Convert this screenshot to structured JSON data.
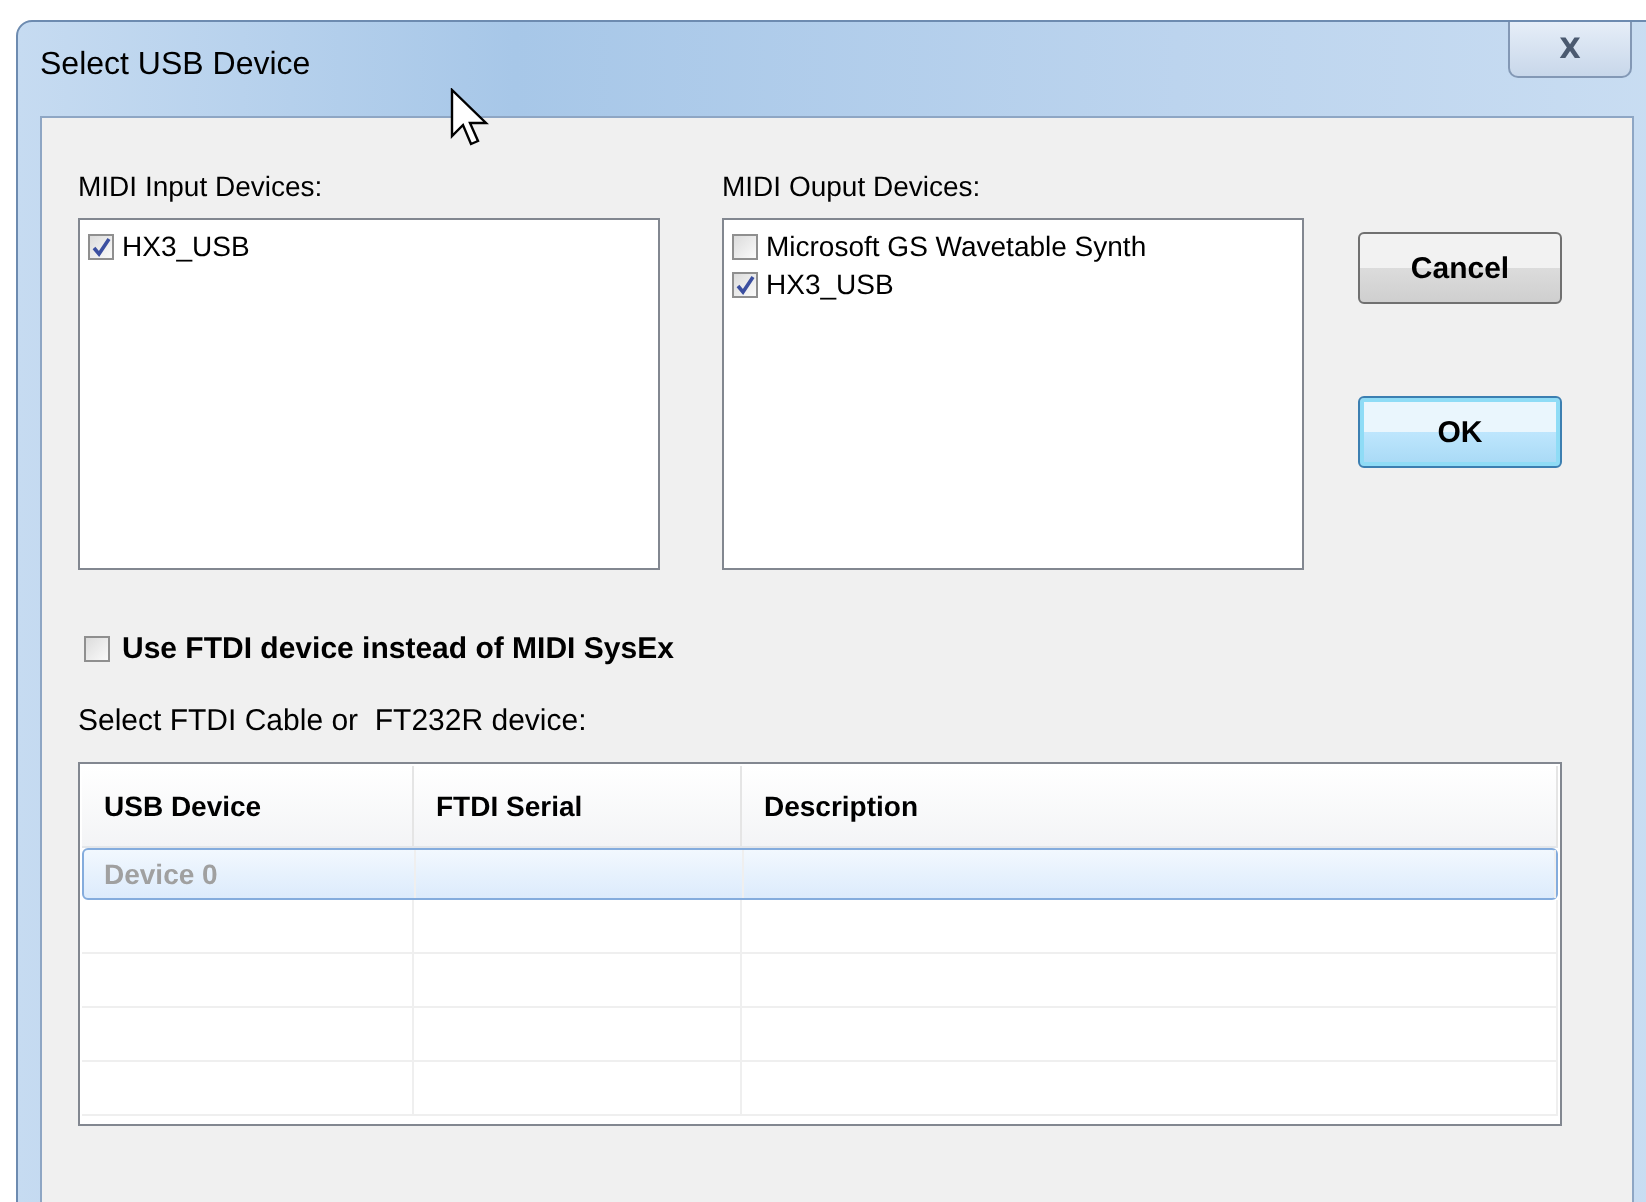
{
  "window": {
    "title": "Select USB Device",
    "close_label": "X"
  },
  "input_devices": {
    "label": "MIDI Input Devices:",
    "items": [
      {
        "label": "HX3_USB",
        "checked": true
      }
    ]
  },
  "output_devices": {
    "label": "MIDI Ouput Devices:",
    "items": [
      {
        "label": "Microsoft GS Wavetable Synth",
        "checked": false
      },
      {
        "label": "HX3_USB",
        "checked": true
      }
    ]
  },
  "buttons": [
    {
      "label": "Cancel",
      "default": false
    },
    {
      "label": "OK",
      "default": true
    }
  ],
  "ftdi_option": {
    "label": "Use FTDI device instead of MIDI SysEx",
    "checked": false
  },
  "table_label": "Select FTDI Cable or  FT232R device:",
  "table": {
    "columns": [
      "USB Device",
      "FTDI Serial",
      "Description"
    ],
    "rows": [
      {
        "cells": [
          "Device 0",
          "",
          ""
        ],
        "selected": true
      }
    ]
  }
}
